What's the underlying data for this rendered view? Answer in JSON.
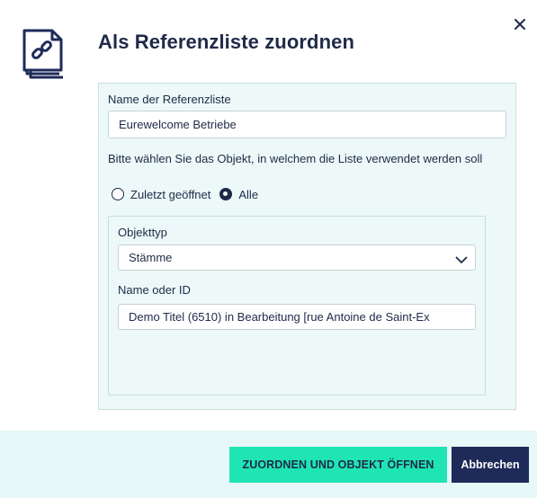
{
  "dialog": {
    "title": "Als Referenzliste zuordnen",
    "icon": "linked-documents-icon",
    "close_icon": "close-icon"
  },
  "form": {
    "name_label": "Name der Referenzliste",
    "name_value": "Eurewelcome Betriebe",
    "object_question": "Bitte wählen Sie das Objekt, in welchem die Liste verwendet werden soll",
    "radio_options": [
      {
        "label": "Zuletzt geöffnet",
        "checked": false
      },
      {
        "label": "Alle",
        "checked": true
      }
    ],
    "object_type_label": "Objekttyp",
    "object_type_value": "Stämme",
    "name_or_id_label": "Name oder ID",
    "name_or_id_value": "Demo Titel (6510) in Bearbeitung [rue Antoine de Saint-Ex"
  },
  "footer": {
    "primary_button": "ZUORDNEN UND OBJEKT ÖFFNEN",
    "secondary_button": "Abbrechen"
  },
  "colors": {
    "navy": "#1e2a48",
    "accent": "#1fe5b5",
    "panel_bg": "#edf8f8"
  }
}
